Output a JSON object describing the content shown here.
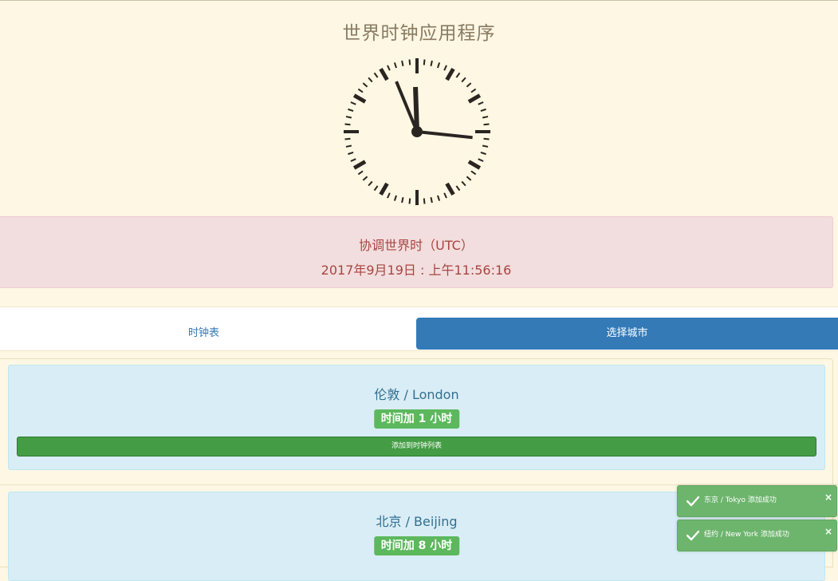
{
  "header": {
    "title": "世界时钟应用程序"
  },
  "clock": {
    "icon": "analog-clock-icon",
    "hour": 11,
    "minute": 56,
    "second": 16
  },
  "utc": {
    "label": "协调世界时（UTC）",
    "datetime": "2017年9月19日 : 上午11:56:16"
  },
  "tabs": [
    {
      "label": "时钟表",
      "active": false
    },
    {
      "label": "选择城市",
      "active": true
    }
  ],
  "cities": [
    {
      "name": "伦敦 / London",
      "offset": "时间加 1 小时",
      "add_label": "添加到时钟列表"
    },
    {
      "name": "北京 / Beijing",
      "offset": "时间加 8 小时"
    }
  ],
  "toasts": [
    {
      "message": "东京 / Tokyo 添加成功",
      "close": "×",
      "icon": "check-icon"
    },
    {
      "message": "纽约 / New York 添加成功",
      "close": "×",
      "icon": "check-icon"
    }
  ],
  "colors": {
    "background": "#fdf7e3",
    "danger_panel": "#f2dede",
    "info_card": "#d9edf7",
    "primary": "#337ab7",
    "success": "#5cb85c"
  }
}
